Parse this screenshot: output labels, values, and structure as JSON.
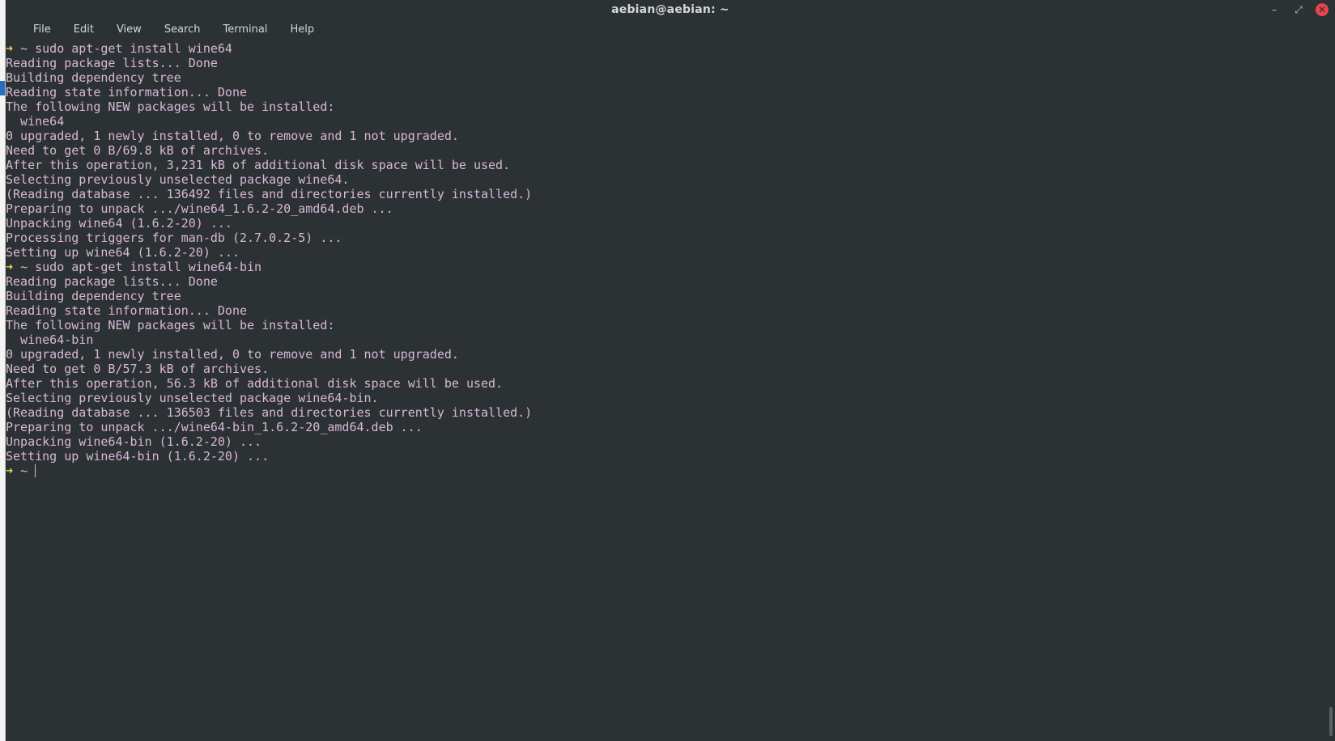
{
  "window": {
    "title": "aebian@aebian: ~"
  },
  "menu": {
    "items": [
      "File",
      "Edit",
      "View",
      "Search",
      "Terminal",
      "Help"
    ]
  },
  "terminal": {
    "prompt_symbol": "➜",
    "prompt_dir": "~",
    "lines": [
      {
        "type": "prompt",
        "command": "sudo apt-get install wine64"
      },
      {
        "type": "out",
        "text": "Reading package lists... Done"
      },
      {
        "type": "out",
        "text": "Building dependency tree"
      },
      {
        "type": "out",
        "text": "Reading state information... Done"
      },
      {
        "type": "out",
        "text": "The following NEW packages will be installed:"
      },
      {
        "type": "out",
        "text": "  wine64"
      },
      {
        "type": "out",
        "text": "0 upgraded, 1 newly installed, 0 to remove and 1 not upgraded."
      },
      {
        "type": "out",
        "text": "Need to get 0 B/69.8 kB of archives."
      },
      {
        "type": "out",
        "text": "After this operation, 3,231 kB of additional disk space will be used."
      },
      {
        "type": "out",
        "text": "Selecting previously unselected package wine64."
      },
      {
        "type": "out",
        "text": "(Reading database ... 136492 files and directories currently installed.)"
      },
      {
        "type": "out",
        "text": "Preparing to unpack .../wine64_1.6.2-20_amd64.deb ..."
      },
      {
        "type": "out",
        "text": "Unpacking wine64 (1.6.2-20) ..."
      },
      {
        "type": "out",
        "text": "Processing triggers for man-db (2.7.0.2-5) ..."
      },
      {
        "type": "out",
        "text": "Setting up wine64 (1.6.2-20) ..."
      },
      {
        "type": "prompt",
        "command": "sudo apt-get install wine64-bin"
      },
      {
        "type": "out",
        "text": "Reading package lists... Done"
      },
      {
        "type": "out",
        "text": "Building dependency tree"
      },
      {
        "type": "out",
        "text": "Reading state information... Done"
      },
      {
        "type": "out",
        "text": "The following NEW packages will be installed:"
      },
      {
        "type": "out",
        "text": "  wine64-bin"
      },
      {
        "type": "out",
        "text": "0 upgraded, 1 newly installed, 0 to remove and 1 not upgraded."
      },
      {
        "type": "out",
        "text": "Need to get 0 B/57.3 kB of archives."
      },
      {
        "type": "out",
        "text": "After this operation, 56.3 kB of additional disk space will be used."
      },
      {
        "type": "out",
        "text": "Selecting previously unselected package wine64-bin."
      },
      {
        "type": "out",
        "text": "(Reading database ... 136503 files and directories currently installed.)"
      },
      {
        "type": "out",
        "text": "Preparing to unpack .../wine64-bin_1.6.2-20_amd64.deb ..."
      },
      {
        "type": "out",
        "text": "Unpacking wine64-bin (1.6.2-20) ..."
      },
      {
        "type": "out",
        "text": "Setting up wine64-bin (1.6.2-20) ..."
      },
      {
        "type": "prompt",
        "command": ""
      }
    ]
  },
  "colors": {
    "background": "#2c3134",
    "text": "#d7b8d6",
    "prompt_arrow": "#e8d84a",
    "close_button": "#e8444b"
  }
}
